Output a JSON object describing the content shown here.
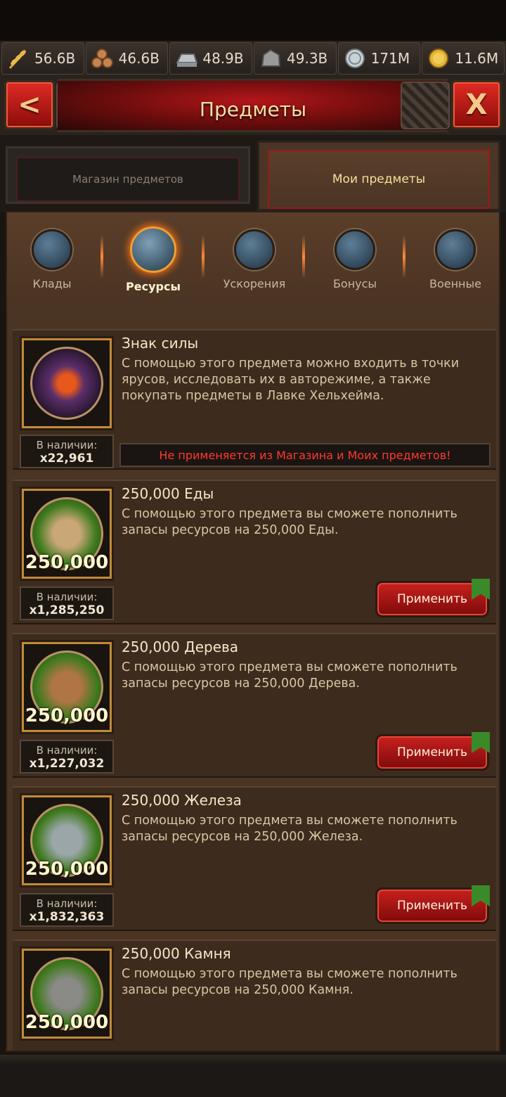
{
  "resources": [
    {
      "icon": "wheat-icon",
      "value": "56.6B"
    },
    {
      "icon": "wood-icon",
      "value": "46.6B"
    },
    {
      "icon": "iron-icon",
      "value": "48.9B"
    },
    {
      "icon": "stone-icon",
      "value": "49.3B"
    },
    {
      "icon": "silver-icon",
      "value": "171M"
    },
    {
      "icon": "gold-icon",
      "value": "11.6M"
    }
  ],
  "header": {
    "title": "Предметы",
    "back": "<",
    "close": "X"
  },
  "tabs": {
    "shop": "Магазин предметов",
    "mine": "Мои предметы"
  },
  "categories": [
    {
      "label": "Клады",
      "active": false
    },
    {
      "label": "Ресурсы",
      "active": true
    },
    {
      "label": "Ускорения",
      "active": false
    },
    {
      "label": "Бонусы",
      "active": false
    },
    {
      "label": "Военные",
      "active": false
    }
  ],
  "items": [
    {
      "title": "Знак силы",
      "desc": "С помощью этого предмета можно входить в точки ярусов, исследовать их в авторежиме, а также покупать предметы в Лавке Хельхейма.",
      "stock_label": "В наличии:",
      "stock": "x22,961",
      "qty": "",
      "warning": "Не применяется из Магазина и Моих предметов!"
    },
    {
      "title": "250,000 Еды",
      "desc": "С помощью этого предмета вы сможете пополнить запасы ресурсов на 250,000 Еды.",
      "stock_label": "В наличии:",
      "stock": "x1,285,250",
      "qty": "250,000",
      "apply": "Применить"
    },
    {
      "title": "250,000 Дерева",
      "desc": "С помощью этого предмета вы сможете пополнить запасы ресурсов на 250,000 Дерева.",
      "stock_label": "В наличии:",
      "stock": "x1,227,032",
      "qty": "250,000",
      "apply": "Применить"
    },
    {
      "title": "250,000 Железа",
      "desc": "С помощью этого предмета вы сможете пополнить запасы ресурсов на 250,000 Железа.",
      "stock_label": "В наличии:",
      "stock": "x1,832,363",
      "qty": "250,000",
      "apply": "Применить"
    },
    {
      "title": "250,000 Камня",
      "desc": "С помощью этого предмета вы сможете пополнить запасы ресурсов на 250,000 Камня.",
      "qty": "250,000"
    }
  ]
}
